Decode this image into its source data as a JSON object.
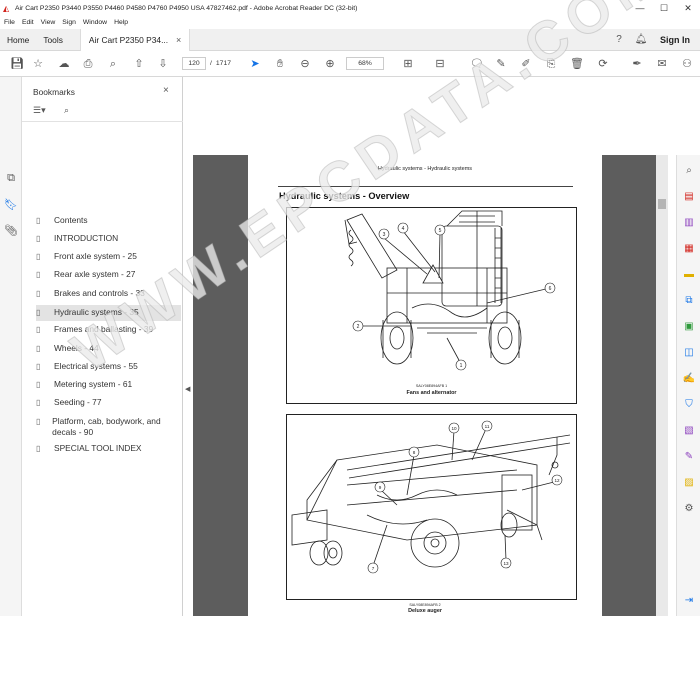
{
  "window": {
    "title": "Air Cart P2350 P3440 P3550 P4460 P4580 P4760 P4950 USA 47827462.pdf - Adobe Acrobat Reader DC (32-bit)",
    "minimize": "—",
    "maximize": "☐",
    "close": "✕"
  },
  "menu": [
    "File",
    "Edit",
    "View",
    "Sign",
    "Window",
    "Help"
  ],
  "tabs": {
    "home": "Home",
    "tools": "Tools",
    "document": "Air Cart P2350 P34...",
    "close": "×",
    "signin": "Sign In"
  },
  "toolbar": {
    "page_current": "120",
    "page_sep": "/",
    "page_total": "1717",
    "zoom": "68%"
  },
  "bookmarks": {
    "header": "Bookmarks",
    "close": "×",
    "items": [
      "Contents",
      "INTRODUCTION",
      "Front axle system - 25",
      "Rear axle system - 27",
      "Brakes and controls - 33",
      "Hydraulic systems - 35",
      "Frames and ballasting - 39",
      "Wheels - 44",
      "Electrical systems - 55",
      "Metering system - 61",
      "Seeding - 77",
      "Platform, cab, bodywork, and decals - 90",
      "SPECIAL TOOL INDEX"
    ],
    "selected_index": 5
  },
  "document_page": {
    "header": "Hydraulic systems - Hydraulic systems",
    "heading": "Hydraulic systems - Overview",
    "figure1": {
      "code": "SALY08E894AFB   1",
      "caption": "Fans and alternator",
      "callouts": [
        "1",
        "2",
        "3",
        "4",
        "5",
        "6"
      ]
    },
    "figure2": {
      "code": "SALY08E894AFB   2",
      "caption": "Deluxe auger",
      "callouts": [
        "6",
        "7",
        "8",
        "9",
        "10",
        "11",
        "12",
        "13"
      ]
    }
  },
  "watermark": "WWW.EPCDATA.COM",
  "colors": {
    "viewer_bg": "#5d5d5d",
    "accent_blue": "#1473e6",
    "adobe_red": "#d2231c",
    "selected_bookmark": "#e3e3e3"
  }
}
